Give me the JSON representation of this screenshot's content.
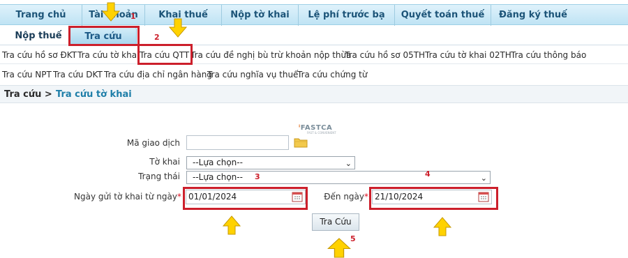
{
  "topnav": {
    "items": [
      "Trang chủ",
      "Tài khoản",
      "Khai thuế",
      "Nộp tờ khai",
      "Lệ phí trước bạ",
      "Quyết toán thuế",
      "Đăng ký thuế"
    ]
  },
  "subtabs": {
    "nop_thue": "Nộp thuế",
    "tra_cuu": "Tra cứu"
  },
  "links_row1": [
    "Tra cứu hồ sơ ĐKT",
    "Tra cứu tờ khai",
    "Tra cứu QTT",
    "Tra cứu đề nghị bù trừ khoản nộp thừa",
    "Tra cứu hồ sơ 05TH",
    "Tra cứu tờ khai 02TH",
    "Tra cứu thông báo"
  ],
  "links_row2": [
    "Tra cứu NPT",
    "Tra cứu DKT",
    "Tra cứu địa chỉ ngân hàng",
    "Tra cứu nghĩa vụ thuế",
    "Tra cứu chứng từ"
  ],
  "breadcrumb": {
    "root": "Tra cứu >",
    "current": "Tra cứu tờ khai"
  },
  "logo": {
    "name": "FASTCA",
    "tagline": "FAST & CONVENIENT"
  },
  "form": {
    "ma_giao_dich_label": "Mã giao dịch",
    "ma_giao_dich_value": "",
    "to_khai_label": "Tờ khai",
    "to_khai_value": "--Lựa chọn--",
    "trang_thai_label": "Trạng thái",
    "trang_thai_value": "--Lựa chọn--",
    "tu_ngay_label": "Ngày gửi tờ khai từ ngày",
    "tu_ngay_value": "01/01/2024",
    "den_ngay_label": "Đến ngày",
    "den_ngay_value": "21/10/2024",
    "required_mark": "*",
    "submit_label": "Tra Cứu"
  },
  "annotations": {
    "numbers": [
      "1",
      "2",
      "3",
      "4",
      "5"
    ],
    "box_color": "#cc1f2b",
    "arrow_color": "#ffd200"
  }
}
